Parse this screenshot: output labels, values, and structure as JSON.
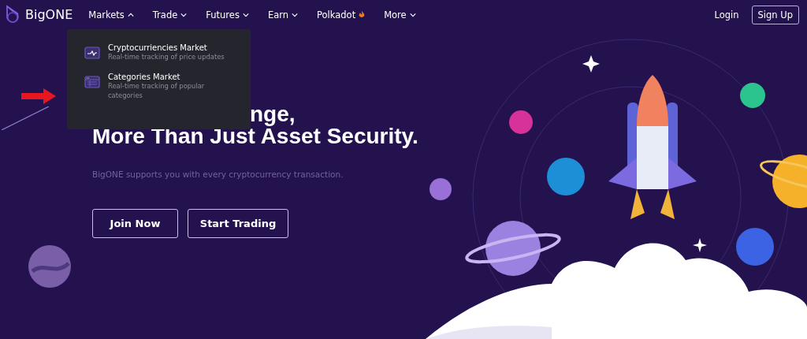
{
  "logo": {
    "text": "BigONE"
  },
  "nav": [
    {
      "label": "Markets",
      "kind": "dropdown",
      "expanded": true
    },
    {
      "label": "Trade",
      "kind": "dropdown",
      "expanded": false
    },
    {
      "label": "Futures",
      "kind": "dropdown",
      "expanded": false
    },
    {
      "label": "Earn",
      "kind": "dropdown",
      "expanded": false
    },
    {
      "label": "Polkadot",
      "kind": "hot"
    },
    {
      "label": "More",
      "kind": "dropdown",
      "expanded": false
    }
  ],
  "auth": {
    "login": "Login",
    "signup": "Sign Up"
  },
  "menu": {
    "items": [
      {
        "title": "Cryptocurriencies Market",
        "description": "Real-time tracking of price updates",
        "kind": "chart"
      },
      {
        "title": "Categories Market",
        "description": "Real-time tracking of popular categories",
        "kind": "list"
      }
    ]
  },
  "hero": {
    "headline_visible": "nge,",
    "headline_line2": "More Than Just Asset Security.",
    "subtitle": "BigONE supports you with every cryptocurrency transaction.",
    "buttons": [
      "Join Now",
      "Start Trading"
    ]
  }
}
